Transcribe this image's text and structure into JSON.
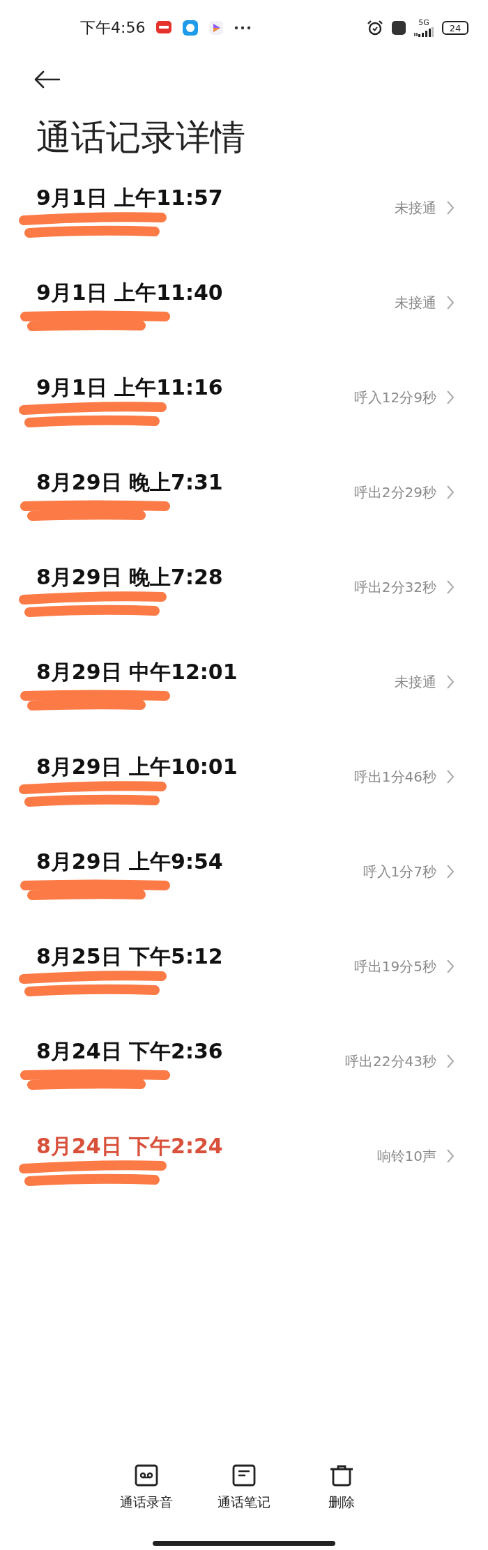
{
  "status_bar": {
    "time": "下午4:56",
    "network": "5G",
    "battery": "24"
  },
  "header": {
    "title": "通话记录详情"
  },
  "calls": [
    {
      "date": "9月1日 上午11:57",
      "status": "未接通",
      "missed": false
    },
    {
      "date": "9月1日 上午11:40",
      "status": "未接通",
      "missed": false
    },
    {
      "date": "9月1日 上午11:16",
      "status": "呼入12分9秒",
      "missed": false
    },
    {
      "date": "8月29日 晚上7:31",
      "status": "呼出2分29秒",
      "missed": false
    },
    {
      "date": "8月29日 晚上7:28",
      "status": "呼出2分32秒",
      "missed": false
    },
    {
      "date": "8月29日 中午12:01",
      "status": "未接通",
      "missed": false
    },
    {
      "date": "8月29日 上午10:01",
      "status": "呼出1分46秒",
      "missed": false
    },
    {
      "date": "8月29日 上午9:54",
      "status": "呼入1分7秒",
      "missed": false
    },
    {
      "date": "8月25日 下午5:12",
      "status": "呼出19分5秒",
      "missed": false
    },
    {
      "date": "8月24日 下午2:36",
      "status": "呼出22分43秒",
      "missed": false
    },
    {
      "date": "8月24日 下午2:24",
      "status": "响铃10声",
      "missed": true
    }
  ],
  "toolbar": [
    {
      "kind": "recording",
      "label": "通话录音"
    },
    {
      "kind": "notes",
      "label": "通话笔记"
    },
    {
      "kind": "delete",
      "label": "删除"
    }
  ]
}
